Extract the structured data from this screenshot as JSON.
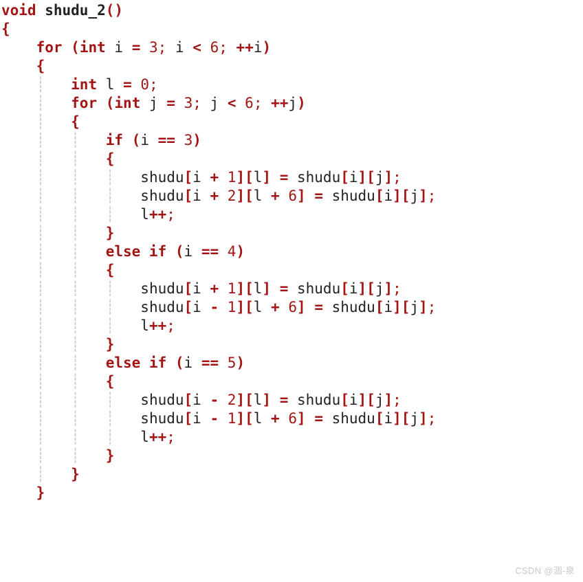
{
  "watermark": "CSDN @涸-泉",
  "code": {
    "tokens": [
      [
        {
          "c": "kw",
          "t": "void"
        },
        {
          "c": "id",
          "t": " "
        },
        {
          "c": "fn",
          "t": "shudu_2"
        },
        {
          "c": "pr",
          "t": "()"
        }
      ],
      [
        {
          "c": "br",
          "t": "{"
        }
      ],
      [
        {
          "c": "id",
          "t": "    "
        },
        {
          "c": "kw",
          "t": "for"
        },
        {
          "c": "id",
          "t": " "
        },
        {
          "c": "pr",
          "t": "("
        },
        {
          "c": "kw",
          "t": "int"
        },
        {
          "c": "id",
          "t": " i "
        },
        {
          "c": "op",
          "t": "="
        },
        {
          "c": "id",
          "t": " "
        },
        {
          "c": "num",
          "t": "3"
        },
        {
          "c": "semi",
          "t": ";"
        },
        {
          "c": "id",
          "t": " i "
        },
        {
          "c": "op",
          "t": "<"
        },
        {
          "c": "id",
          "t": " "
        },
        {
          "c": "num",
          "t": "6"
        },
        {
          "c": "semi",
          "t": ";"
        },
        {
          "c": "id",
          "t": " "
        },
        {
          "c": "op",
          "t": "++"
        },
        {
          "c": "id",
          "t": "i"
        },
        {
          "c": "pr",
          "t": ")"
        }
      ],
      [
        {
          "c": "id",
          "t": "    "
        },
        {
          "c": "br",
          "t": "{"
        }
      ],
      [
        {
          "c": "g",
          "t": "    ┊   "
        },
        {
          "c": "kw",
          "t": "int"
        },
        {
          "c": "id",
          "t": " l "
        },
        {
          "c": "op",
          "t": "="
        },
        {
          "c": "id",
          "t": " "
        },
        {
          "c": "num",
          "t": "0"
        },
        {
          "c": "semi",
          "t": ";"
        }
      ],
      [
        {
          "c": "g",
          "t": "    ┊   "
        },
        {
          "c": "kw",
          "t": "for"
        },
        {
          "c": "id",
          "t": " "
        },
        {
          "c": "pr",
          "t": "("
        },
        {
          "c": "kw",
          "t": "int"
        },
        {
          "c": "id",
          "t": " j "
        },
        {
          "c": "op",
          "t": "="
        },
        {
          "c": "id",
          "t": " "
        },
        {
          "c": "num",
          "t": "3"
        },
        {
          "c": "semi",
          "t": ";"
        },
        {
          "c": "id",
          "t": " j "
        },
        {
          "c": "op",
          "t": "<"
        },
        {
          "c": "id",
          "t": " "
        },
        {
          "c": "num",
          "t": "6"
        },
        {
          "c": "semi",
          "t": ";"
        },
        {
          "c": "id",
          "t": " "
        },
        {
          "c": "op",
          "t": "++"
        },
        {
          "c": "id",
          "t": "j"
        },
        {
          "c": "pr",
          "t": ")"
        }
      ],
      [
        {
          "c": "g",
          "t": "    ┊   "
        },
        {
          "c": "br",
          "t": "{"
        }
      ],
      [
        {
          "c": "g",
          "t": "    ┊   ┊   "
        },
        {
          "c": "kw",
          "t": "if"
        },
        {
          "c": "id",
          "t": " "
        },
        {
          "c": "pr",
          "t": "("
        },
        {
          "c": "id",
          "t": "i "
        },
        {
          "c": "op",
          "t": "=="
        },
        {
          "c": "id",
          "t": " "
        },
        {
          "c": "num",
          "t": "3"
        },
        {
          "c": "pr",
          "t": ")"
        }
      ],
      [
        {
          "c": "g",
          "t": "    ┊   ┊   "
        },
        {
          "c": "br",
          "t": "{"
        }
      ],
      [
        {
          "c": "g",
          "t": "    ┊   ┊   ┊   "
        },
        {
          "c": "id",
          "t": "shudu"
        },
        {
          "c": "bk",
          "t": "["
        },
        {
          "c": "id",
          "t": "i "
        },
        {
          "c": "op",
          "t": "+"
        },
        {
          "c": "id",
          "t": " "
        },
        {
          "c": "num",
          "t": "1"
        },
        {
          "c": "bk",
          "t": "]["
        },
        {
          "c": "id",
          "t": "l"
        },
        {
          "c": "bk",
          "t": "]"
        },
        {
          "c": "id",
          "t": " "
        },
        {
          "c": "op",
          "t": "="
        },
        {
          "c": "id",
          "t": " shudu"
        },
        {
          "c": "bk",
          "t": "["
        },
        {
          "c": "id",
          "t": "i"
        },
        {
          "c": "bk",
          "t": "]["
        },
        {
          "c": "id",
          "t": "j"
        },
        {
          "c": "bk",
          "t": "]"
        },
        {
          "c": "semi",
          "t": ";"
        }
      ],
      [
        {
          "c": "g",
          "t": "    ┊   ┊   ┊   "
        },
        {
          "c": "id",
          "t": "shudu"
        },
        {
          "c": "bk",
          "t": "["
        },
        {
          "c": "id",
          "t": "i "
        },
        {
          "c": "op",
          "t": "+"
        },
        {
          "c": "id",
          "t": " "
        },
        {
          "c": "num",
          "t": "2"
        },
        {
          "c": "bk",
          "t": "]["
        },
        {
          "c": "id",
          "t": "l "
        },
        {
          "c": "op",
          "t": "+"
        },
        {
          "c": "id",
          "t": " "
        },
        {
          "c": "num",
          "t": "6"
        },
        {
          "c": "bk",
          "t": "]"
        },
        {
          "c": "id",
          "t": " "
        },
        {
          "c": "op",
          "t": "="
        },
        {
          "c": "id",
          "t": " shudu"
        },
        {
          "c": "bk",
          "t": "["
        },
        {
          "c": "id",
          "t": "i"
        },
        {
          "c": "bk",
          "t": "]["
        },
        {
          "c": "id",
          "t": "j"
        },
        {
          "c": "bk",
          "t": "]"
        },
        {
          "c": "semi",
          "t": ";"
        }
      ],
      [
        {
          "c": "g",
          "t": "    ┊   ┊   ┊   "
        },
        {
          "c": "id",
          "t": "l"
        },
        {
          "c": "op",
          "t": "++"
        },
        {
          "c": "semi",
          "t": ";"
        }
      ],
      [
        {
          "c": "g",
          "t": "    ┊   ┊   "
        },
        {
          "c": "br",
          "t": "}"
        }
      ],
      [
        {
          "c": "g",
          "t": "    ┊   ┊   "
        },
        {
          "c": "kw",
          "t": "else if"
        },
        {
          "c": "id",
          "t": " "
        },
        {
          "c": "pr",
          "t": "("
        },
        {
          "c": "id",
          "t": "i "
        },
        {
          "c": "op",
          "t": "=="
        },
        {
          "c": "id",
          "t": " "
        },
        {
          "c": "num",
          "t": "4"
        },
        {
          "c": "pr",
          "t": ")"
        }
      ],
      [
        {
          "c": "g",
          "t": "    ┊   ┊   "
        },
        {
          "c": "br",
          "t": "{"
        }
      ],
      [
        {
          "c": "g",
          "t": "    ┊   ┊   ┊   "
        },
        {
          "c": "id",
          "t": "shudu"
        },
        {
          "c": "bk",
          "t": "["
        },
        {
          "c": "id",
          "t": "i "
        },
        {
          "c": "op",
          "t": "+"
        },
        {
          "c": "id",
          "t": " "
        },
        {
          "c": "num",
          "t": "1"
        },
        {
          "c": "bk",
          "t": "]["
        },
        {
          "c": "id",
          "t": "l"
        },
        {
          "c": "bk",
          "t": "]"
        },
        {
          "c": "id",
          "t": " "
        },
        {
          "c": "op",
          "t": "="
        },
        {
          "c": "id",
          "t": " shudu"
        },
        {
          "c": "bk",
          "t": "["
        },
        {
          "c": "id",
          "t": "i"
        },
        {
          "c": "bk",
          "t": "]["
        },
        {
          "c": "id",
          "t": "j"
        },
        {
          "c": "bk",
          "t": "]"
        },
        {
          "c": "semi",
          "t": ";"
        }
      ],
      [
        {
          "c": "g",
          "t": "    ┊   ┊   ┊   "
        },
        {
          "c": "id",
          "t": "shudu"
        },
        {
          "c": "bk",
          "t": "["
        },
        {
          "c": "id",
          "t": "i "
        },
        {
          "c": "op",
          "t": "-"
        },
        {
          "c": "id",
          "t": " "
        },
        {
          "c": "num",
          "t": "1"
        },
        {
          "c": "bk",
          "t": "]["
        },
        {
          "c": "id",
          "t": "l "
        },
        {
          "c": "op",
          "t": "+"
        },
        {
          "c": "id",
          "t": " "
        },
        {
          "c": "num",
          "t": "6"
        },
        {
          "c": "bk",
          "t": "]"
        },
        {
          "c": "id",
          "t": " "
        },
        {
          "c": "op",
          "t": "="
        },
        {
          "c": "id",
          "t": " shudu"
        },
        {
          "c": "bk",
          "t": "["
        },
        {
          "c": "id",
          "t": "i"
        },
        {
          "c": "bk",
          "t": "]["
        },
        {
          "c": "id",
          "t": "j"
        },
        {
          "c": "bk",
          "t": "]"
        },
        {
          "c": "semi",
          "t": ";"
        }
      ],
      [
        {
          "c": "g",
          "t": "    ┊   ┊   ┊   "
        },
        {
          "c": "id",
          "t": "l"
        },
        {
          "c": "op",
          "t": "++"
        },
        {
          "c": "semi",
          "t": ";"
        }
      ],
      [
        {
          "c": "g",
          "t": "    ┊   ┊   "
        },
        {
          "c": "br",
          "t": "}"
        }
      ],
      [
        {
          "c": "g",
          "t": "    ┊   ┊   "
        },
        {
          "c": "kw",
          "t": "else if"
        },
        {
          "c": "id",
          "t": " "
        },
        {
          "c": "pr",
          "t": "("
        },
        {
          "c": "id",
          "t": "i "
        },
        {
          "c": "op",
          "t": "=="
        },
        {
          "c": "id",
          "t": " "
        },
        {
          "c": "num",
          "t": "5"
        },
        {
          "c": "pr",
          "t": ")"
        }
      ],
      [
        {
          "c": "g",
          "t": "    ┊   ┊   "
        },
        {
          "c": "br",
          "t": "{"
        }
      ],
      [
        {
          "c": "g",
          "t": "    ┊   ┊   ┊   "
        },
        {
          "c": "id",
          "t": "shudu"
        },
        {
          "c": "bk",
          "t": "["
        },
        {
          "c": "id",
          "t": "i "
        },
        {
          "c": "op",
          "t": "-"
        },
        {
          "c": "id",
          "t": " "
        },
        {
          "c": "num",
          "t": "2"
        },
        {
          "c": "bk",
          "t": "]["
        },
        {
          "c": "id",
          "t": "l"
        },
        {
          "c": "bk",
          "t": "]"
        },
        {
          "c": "id",
          "t": " "
        },
        {
          "c": "op",
          "t": "="
        },
        {
          "c": "id",
          "t": " shudu"
        },
        {
          "c": "bk",
          "t": "["
        },
        {
          "c": "id",
          "t": "i"
        },
        {
          "c": "bk",
          "t": "]["
        },
        {
          "c": "id",
          "t": "j"
        },
        {
          "c": "bk",
          "t": "]"
        },
        {
          "c": "semi",
          "t": ";"
        }
      ],
      [
        {
          "c": "g",
          "t": "    ┊   ┊   ┊   "
        },
        {
          "c": "id",
          "t": "shudu"
        },
        {
          "c": "bk",
          "t": "["
        },
        {
          "c": "id",
          "t": "i "
        },
        {
          "c": "op",
          "t": "-"
        },
        {
          "c": "id",
          "t": " "
        },
        {
          "c": "num",
          "t": "1"
        },
        {
          "c": "bk",
          "t": "]["
        },
        {
          "c": "id",
          "t": "l "
        },
        {
          "c": "op",
          "t": "+"
        },
        {
          "c": "id",
          "t": " "
        },
        {
          "c": "num",
          "t": "6"
        },
        {
          "c": "bk",
          "t": "]"
        },
        {
          "c": "id",
          "t": " "
        },
        {
          "c": "op",
          "t": "="
        },
        {
          "c": "id",
          "t": " shudu"
        },
        {
          "c": "bk",
          "t": "["
        },
        {
          "c": "id",
          "t": "i"
        },
        {
          "c": "bk",
          "t": "]["
        },
        {
          "c": "id",
          "t": "j"
        },
        {
          "c": "bk",
          "t": "]"
        },
        {
          "c": "semi",
          "t": ";"
        }
      ],
      [
        {
          "c": "g",
          "t": "    ┊   ┊   ┊   "
        },
        {
          "c": "id",
          "t": "l"
        },
        {
          "c": "op",
          "t": "++"
        },
        {
          "c": "semi",
          "t": ";"
        }
      ],
      [
        {
          "c": "g",
          "t": "    ┊   ┊   "
        },
        {
          "c": "br",
          "t": "}"
        }
      ],
      [
        {
          "c": "g",
          "t": "    ┊   "
        },
        {
          "c": "br",
          "t": "}"
        }
      ],
      [
        {
          "c": "id",
          "t": "    "
        },
        {
          "c": "br",
          "t": "}"
        }
      ]
    ]
  }
}
